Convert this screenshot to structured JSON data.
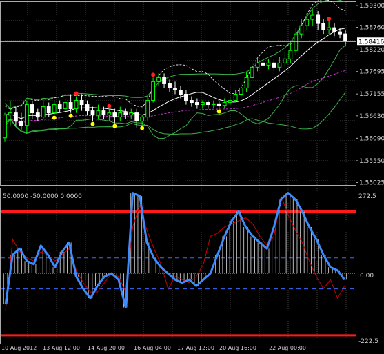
{
  "price_panel": {
    "axis_ticks": [
      "1.59300",
      "1.58760",
      "1.58220",
      "1.57695",
      "1.57155",
      "1.56630",
      "1.56090",
      "1.55550",
      "1.55025"
    ],
    "current_price": "1.58416",
    "current_value": 1.58416,
    "price_range": [
      1.55,
      1.5935
    ],
    "colors": {
      "bull_candle": "#00ff00",
      "bear_candle": "#ffffff",
      "bollinger": "#3cb44b",
      "ma_white": "#ffffff",
      "ma_magenta": "#cc33cc",
      "dotted_line": "#ffffff",
      "signal_red": "#ff2020",
      "signal_yellow": "#ffff00",
      "grid": "#5a5a5a"
    }
  },
  "indicator_panel": {
    "header": "50.0000 -50.0000 0.0000",
    "axis_ticks": [
      "272.5",
      "0.00",
      "-222.5"
    ],
    "value_range": [
      -222.5,
      272.5
    ],
    "levels": {
      "upper_red": 200,
      "lower_red": -200,
      "upper_dash": 50,
      "lower_dash": -50
    },
    "colors": {
      "main_line": "#3c8cff",
      "signal_line": "#cc0000",
      "histogram": "#b8b8b8",
      "level_red": "#ff1a1a",
      "level_dash": "#3c6cff"
    }
  },
  "time_axis": {
    "labels": [
      "10 Aug 2012",
      "13 Aug 12:00",
      "14 Aug 20:00",
      "16 Aug 04:00",
      "17 Aug 12:00",
      "20 Aug 16:00",
      "22 Aug 00:00"
    ]
  },
  "chart_data": {
    "type": "candlestick",
    "candles": [
      [
        1.561,
        1.5665,
        1.56,
        1.567
      ],
      [
        1.5665,
        1.567,
        1.564,
        1.57
      ],
      [
        1.567,
        1.565,
        1.564,
        1.5685
      ],
      [
        1.565,
        1.564,
        1.563,
        1.567
      ],
      [
        1.564,
        1.569,
        1.562,
        1.57
      ],
      [
        1.569,
        1.567,
        1.5655,
        1.57
      ],
      [
        1.567,
        1.566,
        1.565,
        1.568
      ],
      [
        1.566,
        1.5685,
        1.5655,
        1.5705
      ],
      [
        1.5685,
        1.567,
        1.566,
        1.5695
      ],
      [
        1.567,
        1.569,
        1.5665,
        1.57
      ],
      [
        1.569,
        1.568,
        1.567,
        1.57
      ],
      [
        1.568,
        1.5695,
        1.567,
        1.5705
      ],
      [
        1.5695,
        1.568,
        1.567,
        1.5715
      ],
      [
        1.568,
        1.57,
        1.567,
        1.571
      ],
      [
        1.57,
        1.569,
        1.5675,
        1.5715
      ],
      [
        1.569,
        1.5675,
        1.5665,
        1.57
      ],
      [
        1.5675,
        1.5665,
        1.565,
        1.5685
      ],
      [
        1.5665,
        1.5675,
        1.5655,
        1.569
      ],
      [
        1.5675,
        1.5665,
        1.5655,
        1.5685
      ],
      [
        1.5665,
        1.567,
        1.565,
        1.568
      ],
      [
        1.567,
        1.566,
        1.5645,
        1.568
      ],
      [
        1.566,
        1.567,
        1.565,
        1.5685
      ],
      [
        1.567,
        1.5665,
        1.5655,
        1.568
      ],
      [
        1.5665,
        1.567,
        1.5655,
        1.568
      ],
      [
        1.567,
        1.565,
        1.5635,
        1.568
      ],
      [
        1.565,
        1.566,
        1.564,
        1.5665
      ],
      [
        1.566,
        1.57,
        1.565,
        1.571
      ],
      [
        1.57,
        1.5745,
        1.5695,
        1.5755
      ],
      [
        1.5745,
        1.5755,
        1.5735,
        1.5765
      ],
      [
        1.5755,
        1.574,
        1.573,
        1.5765
      ],
      [
        1.574,
        1.573,
        1.572,
        1.575
      ],
      [
        1.573,
        1.5725,
        1.5715,
        1.5745
      ],
      [
        1.5725,
        1.5715,
        1.5705,
        1.5735
      ],
      [
        1.5715,
        1.57,
        1.569,
        1.5725
      ],
      [
        1.57,
        1.5695,
        1.5685,
        1.571
      ],
      [
        1.5695,
        1.569,
        1.568,
        1.5705
      ],
      [
        1.569,
        1.5695,
        1.568,
        1.57
      ],
      [
        1.5695,
        1.569,
        1.568,
        1.57
      ],
      [
        1.569,
        1.5692,
        1.5682,
        1.57
      ],
      [
        1.5692,
        1.5688,
        1.568,
        1.57
      ],
      [
        1.5688,
        1.5695,
        1.5682,
        1.5705
      ],
      [
        1.5695,
        1.57,
        1.5688,
        1.571
      ],
      [
        1.57,
        1.5715,
        1.5695,
        1.5725
      ],
      [
        1.5715,
        1.573,
        1.5705,
        1.574
      ],
      [
        1.573,
        1.5755,
        1.572,
        1.577
      ],
      [
        1.5755,
        1.578,
        1.5745,
        1.5795
      ],
      [
        1.578,
        1.579,
        1.577,
        1.5805
      ],
      [
        1.579,
        1.5785,
        1.5775,
        1.58
      ],
      [
        1.5785,
        1.579,
        1.5775,
        1.58
      ],
      [
        1.579,
        1.578,
        1.577,
        1.58
      ],
      [
        1.578,
        1.579,
        1.577,
        1.5805
      ],
      [
        1.579,
        1.58,
        1.578,
        1.5815
      ],
      [
        1.58,
        1.582,
        1.579,
        1.5835
      ],
      [
        1.582,
        1.586,
        1.581,
        1.5875
      ],
      [
        1.586,
        1.588,
        1.585,
        1.5895
      ],
      [
        1.588,
        1.5895,
        1.587,
        1.591
      ],
      [
        1.5895,
        1.5905,
        1.588,
        1.592
      ],
      [
        1.5905,
        1.5885,
        1.587,
        1.5915
      ],
      [
        1.5885,
        1.587,
        1.586,
        1.5895
      ],
      [
        1.587,
        1.5875,
        1.586,
        1.589
      ],
      [
        1.5875,
        1.5865,
        1.5855,
        1.5885
      ],
      [
        1.5865,
        1.586,
        1.585,
        1.5875
      ],
      [
        1.586,
        1.5842,
        1.583,
        1.587
      ]
    ],
    "signals": [
      {
        "bar": 9,
        "kind": "yellow"
      },
      {
        "bar": 12,
        "kind": "yellow"
      },
      {
        "bar": 13,
        "kind": "red"
      },
      {
        "bar": 16,
        "kind": "yellow"
      },
      {
        "bar": 19,
        "kind": "red"
      },
      {
        "bar": 20,
        "kind": "yellow"
      },
      {
        "bar": 25,
        "kind": "yellow"
      },
      {
        "bar": 27,
        "kind": "red"
      },
      {
        "bar": 39,
        "kind": "yellow"
      },
      {
        "bar": 59,
        "kind": "red"
      }
    ],
    "osc_main": [
      -100,
      60,
      80,
      40,
      30,
      90,
      60,
      20,
      70,
      100,
      -10,
      -50,
      -80,
      -40,
      -10,
      0,
      -20,
      -110,
      260,
      250,
      100,
      50,
      20,
      0,
      -20,
      -30,
      -20,
      -40,
      -20,
      0,
      60,
      120,
      170,
      200,
      150,
      120,
      100,
      80,
      150,
      240,
      260,
      240,
      200,
      150,
      110,
      60,
      20,
      10,
      -20
    ],
    "osc_signal": [
      -120,
      110,
      70,
      50,
      40,
      70,
      60,
      40,
      60,
      80,
      10,
      -30,
      -60,
      -60,
      -30,
      0,
      -10,
      -60,
      150,
      220,
      140,
      80,
      30,
      -50,
      -10,
      -20,
      -30,
      -10,
      30,
      120,
      130,
      150,
      160,
      170,
      180,
      160,
      120,
      90,
      120,
      250,
      190,
      140,
      100,
      40,
      -10,
      -50,
      -20,
      -80,
      -40
    ],
    "ylim_price": [
      1.55,
      1.5935
    ],
    "ylim_osc": [
      -222.5,
      272.5
    ]
  }
}
